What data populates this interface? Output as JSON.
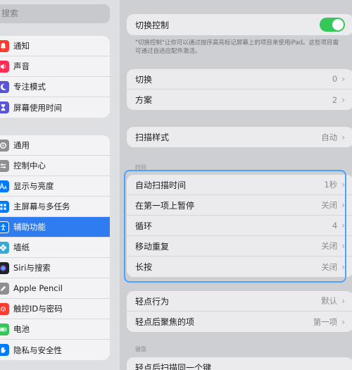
{
  "search": {
    "placeholder": "搜索"
  },
  "sidebar": {
    "group1": [
      {
        "label": "通知",
        "icon": "bell-icon",
        "color": "#ff3b30"
      },
      {
        "label": "声音",
        "icon": "speaker-icon",
        "color": "#ff2d55"
      },
      {
        "label": "专注模式",
        "icon": "moon-icon",
        "color": "#5856d6"
      },
      {
        "label": "屏幕使用时间",
        "icon": "hourglass-icon",
        "color": "#5856d6"
      }
    ],
    "group2": [
      {
        "label": "通用",
        "icon": "gear-icon",
        "color": "#8e8e93"
      },
      {
        "label": "控制中心",
        "icon": "sliders-icon",
        "color": "#8e8e93"
      },
      {
        "label": "显示与亮度",
        "icon": "aa-icon",
        "color": "#007aff"
      },
      {
        "label": "主屏幕与多任务",
        "icon": "grid-icon",
        "color": "#007aff"
      },
      {
        "label": "辅助功能",
        "icon": "accessibility-icon",
        "color": "#007aff"
      },
      {
        "label": "墙纸",
        "icon": "flower-icon",
        "color": "#34aadc"
      },
      {
        "label": "Siri与搜索",
        "icon": "siri-icon",
        "color": "#222222"
      },
      {
        "label": "Apple Pencil",
        "icon": "pencil-icon",
        "color": "#8e8e93"
      },
      {
        "label": "触控ID与密码",
        "icon": "fingerprint-icon",
        "color": "#ff3b30"
      },
      {
        "label": "电池",
        "icon": "battery-icon",
        "color": "#34c759"
      },
      {
        "label": "隐私与安全性",
        "icon": "hand-icon",
        "color": "#007aff"
      }
    ]
  },
  "main": {
    "switch_control": {
      "label": "切换控制",
      "on": true
    },
    "description": "\"切换控制\"让你可以通过按序高亮标记屏幕上的项目来使用iPad。这些项目需可通过自适应配件激活。",
    "card1": [
      {
        "label": "切换",
        "value": "0"
      },
      {
        "label": "方案",
        "value": "2"
      }
    ],
    "card2": [
      {
        "label": "扫描样式",
        "value": "自动"
      }
    ],
    "timing_header": "时间",
    "timing": [
      {
        "label": "自动扫描时间",
        "value": "1秒"
      },
      {
        "label": "在第一项上暂停",
        "value": "关闭"
      },
      {
        "label": "循环",
        "value": "4"
      },
      {
        "label": "移动重复",
        "value": "关闭"
      },
      {
        "label": "长按",
        "value": "关闭"
      }
    ],
    "card4": [
      {
        "label": "轻点行为",
        "value": "默认"
      },
      {
        "label": "轻点后聚焦的项",
        "value": "第一项"
      }
    ],
    "keyboard_header": "键盘",
    "card5": [
      {
        "label": "轻点后扫描同一个键",
        "value": ""
      }
    ],
    "chevron": "›"
  }
}
